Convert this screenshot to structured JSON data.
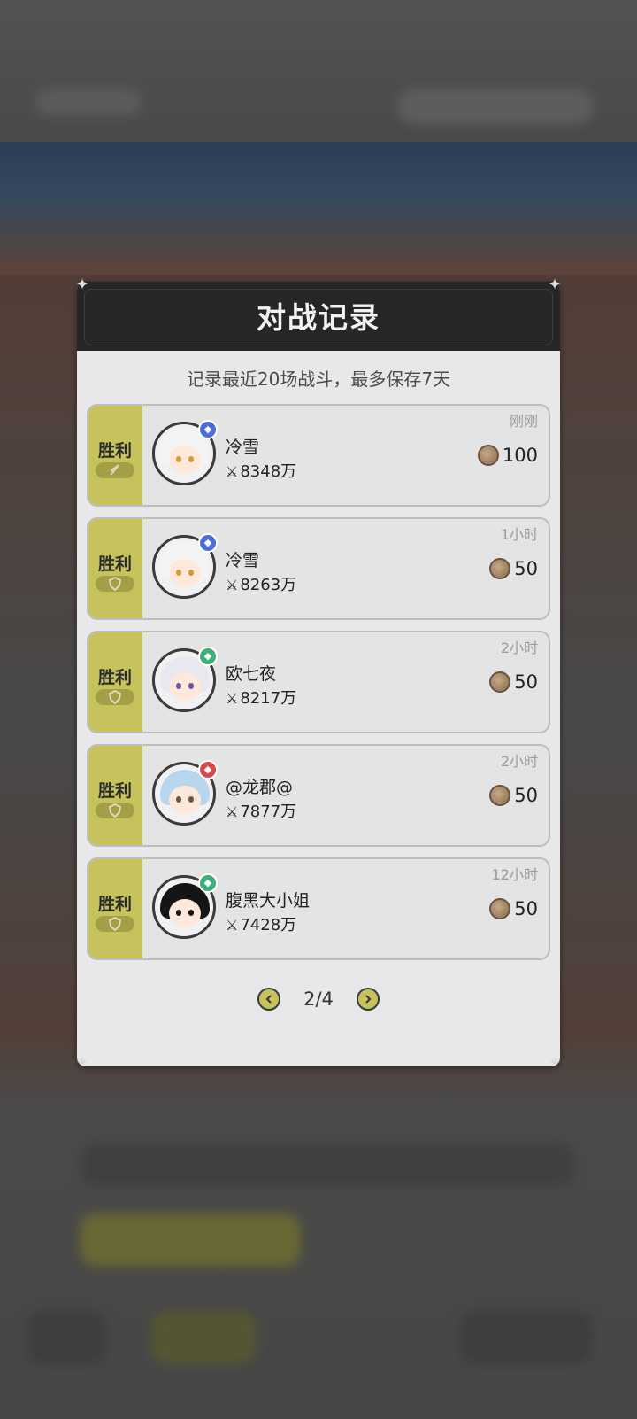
{
  "dialog": {
    "title": "对战记录",
    "subtitle": "记录最近20场战斗，最多保存7天"
  },
  "records": [
    {
      "result": "胜利",
      "name": "冷雪",
      "power": "8348万",
      "time": "刚刚",
      "reward": "100",
      "badge_color": "#4a6fd6",
      "hair": "#f4f4f4",
      "eye": "#d89a3c",
      "pill_icon": "sword-icon"
    },
    {
      "result": "胜利",
      "name": "冷雪",
      "power": "8263万",
      "time": "1小时",
      "reward": "50",
      "badge_color": "#4a6fd6",
      "hair": "#f4f4f4",
      "eye": "#d89a3c",
      "pill_icon": "shield-icon"
    },
    {
      "result": "胜利",
      "name": "欧七夜",
      "power": "8217万",
      "time": "2小时",
      "reward": "50",
      "badge_color": "#3fae7a",
      "hair": "#e8e8ee",
      "eye": "#6b5a9a",
      "pill_icon": "shield-icon"
    },
    {
      "result": "胜利",
      "name": "@龙郡@",
      "power": "7877万",
      "time": "2小时",
      "reward": "50",
      "badge_color": "#d84a4a",
      "hair": "#b8d6ee",
      "eye": "#6a5a3a",
      "pill_icon": "shield-icon"
    },
    {
      "result": "胜利",
      "name": "腹黑大小姐",
      "power": "7428万",
      "time": "12小时",
      "reward": "50",
      "badge_color": "#3fae7a",
      "hair": "#151515",
      "eye": "#151515",
      "pill_icon": "shield-icon"
    }
  ],
  "pagination": {
    "current": "2/4"
  }
}
